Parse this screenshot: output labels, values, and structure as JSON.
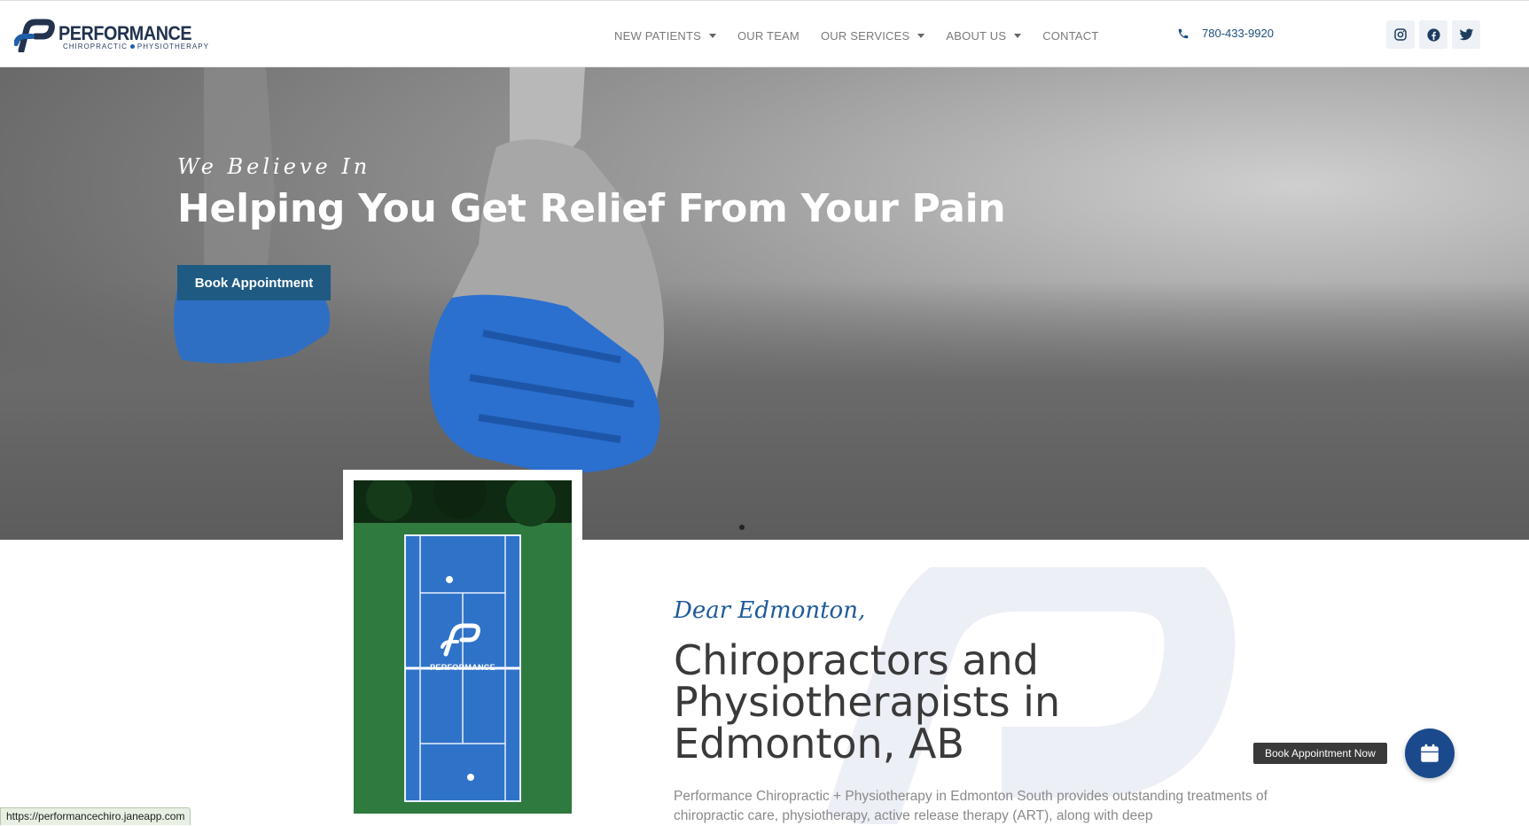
{
  "header": {
    "logo": {
      "wordmark": "PERFORMANCE",
      "tagline_left": "CHIROPRACTIC",
      "tagline_right": "PHYSIOTHERAPY"
    },
    "nav": [
      {
        "label": "NEW PATIENTS",
        "dropdown": true
      },
      {
        "label": "OUR TEAM",
        "dropdown": false
      },
      {
        "label": "OUR SERVICES",
        "dropdown": true
      },
      {
        "label": "ABOUT US",
        "dropdown": true
      },
      {
        "label": "CONTACT",
        "dropdown": false
      }
    ],
    "phone": "780-433-9920",
    "socials": [
      "instagram-icon",
      "facebook-icon",
      "twitter-icon"
    ]
  },
  "hero": {
    "eyebrow": "We Believe In",
    "title": "Helping You Get Relief From Your Pain",
    "button_label": "Book Appointment",
    "slide_count": 1
  },
  "intro": {
    "image_brand": "PERFORMANCE",
    "salutation": "Dear Edmonton,",
    "title": "Chiropractors and Physiotherapists in Edmonton, AB",
    "body": "Performance Chiropractic + Physiotherapy in Edmonton South provides outstanding treatments of chiropractic care, physiotherapy, active release therapy (ART), along with deep"
  },
  "floating_booking": {
    "tooltip": "Book Appointment Now",
    "icon": "calendar-icon"
  },
  "status_bar": {
    "url": "https://performancechiro.janeapp.com"
  },
  "colors": {
    "brand_navy": "#22324f",
    "brand_blue": "#1f5a82",
    "accent_blue": "#1b4a8c",
    "nav_text": "#7a7a7a"
  }
}
